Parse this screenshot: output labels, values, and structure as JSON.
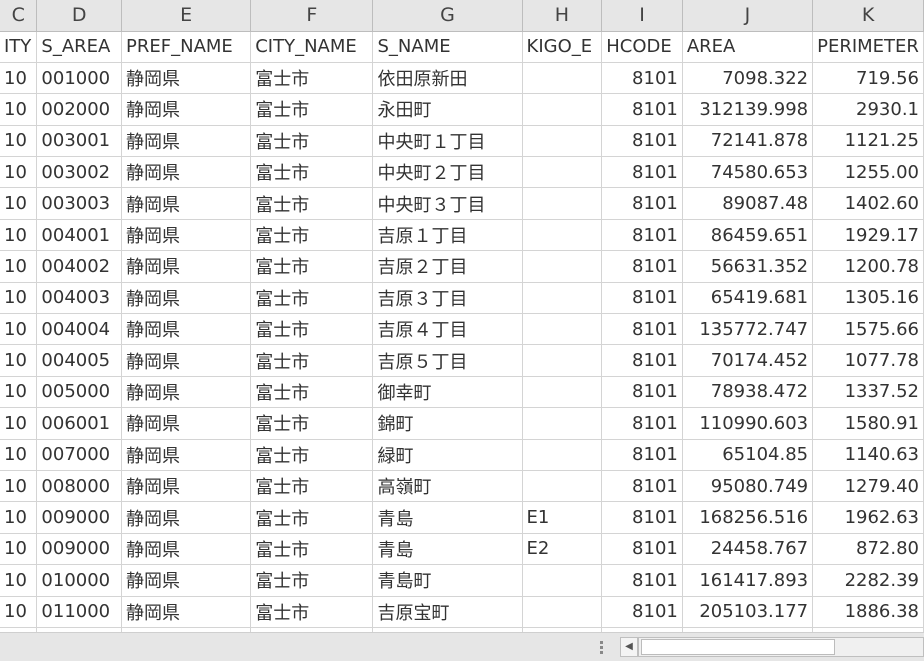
{
  "column_letters": [
    "C",
    "D",
    "E",
    "F",
    "G",
    "H",
    "I",
    "J",
    "K"
  ],
  "field_headers": [
    "ITY",
    "S_AREA",
    "PREF_NAME",
    "CITY_NAME",
    "S_NAME",
    "KIGO_E",
    "HCODE",
    "AREA",
    "PERIMETER"
  ],
  "rows": [
    [
      "10",
      "001000",
      "静岡県",
      "富士市",
      "依田原新田",
      "",
      "8101",
      "7098.322",
      "719.56"
    ],
    [
      "10",
      "002000",
      "静岡県",
      "富士市",
      "永田町",
      "",
      "8101",
      "312139.998",
      "2930.1"
    ],
    [
      "10",
      "003001",
      "静岡県",
      "富士市",
      "中央町１丁目",
      "",
      "8101",
      "72141.878",
      "1121.25"
    ],
    [
      "10",
      "003002",
      "静岡県",
      "富士市",
      "中央町２丁目",
      "",
      "8101",
      "74580.653",
      "1255.00"
    ],
    [
      "10",
      "003003",
      "静岡県",
      "富士市",
      "中央町３丁目",
      "",
      "8101",
      "89087.48",
      "1402.60"
    ],
    [
      "10",
      "004001",
      "静岡県",
      "富士市",
      "吉原１丁目",
      "",
      "8101",
      "86459.651",
      "1929.17"
    ],
    [
      "10",
      "004002",
      "静岡県",
      "富士市",
      "吉原２丁目",
      "",
      "8101",
      "56631.352",
      "1200.78"
    ],
    [
      "10",
      "004003",
      "静岡県",
      "富士市",
      "吉原３丁目",
      "",
      "8101",
      "65419.681",
      "1305.16"
    ],
    [
      "10",
      "004004",
      "静岡県",
      "富士市",
      "吉原４丁目",
      "",
      "8101",
      "135772.747",
      "1575.66"
    ],
    [
      "10",
      "004005",
      "静岡県",
      "富士市",
      "吉原５丁目",
      "",
      "8101",
      "70174.452",
      "1077.78"
    ],
    [
      "10",
      "005000",
      "静岡県",
      "富士市",
      "御幸町",
      "",
      "8101",
      "78938.472",
      "1337.52"
    ],
    [
      "10",
      "006001",
      "静岡県",
      "富士市",
      "錦町",
      "",
      "8101",
      "110990.603",
      "1580.91"
    ],
    [
      "10",
      "007000",
      "静岡県",
      "富士市",
      "緑町",
      "",
      "8101",
      "65104.85",
      "1140.63"
    ],
    [
      "10",
      "008000",
      "静岡県",
      "富士市",
      "高嶺町",
      "",
      "8101",
      "95080.749",
      "1279.40"
    ],
    [
      "10",
      "009000",
      "静岡県",
      "富士市",
      "青島",
      "E1",
      "8101",
      "168256.516",
      "1962.63"
    ],
    [
      "10",
      "009000",
      "静岡県",
      "富士市",
      "青島",
      "E2",
      "8101",
      "24458.767",
      "872.80"
    ],
    [
      "10",
      "010000",
      "静岡県",
      "富士市",
      "青島町",
      "",
      "8101",
      "161417.893",
      "2282.39"
    ],
    [
      "10",
      "011000",
      "静岡県",
      "富士市",
      "吉原宝町",
      "",
      "8101",
      "205103.177",
      "1886.38"
    ],
    [
      "",
      "",
      "",
      "",
      "",
      "",
      "",
      "",
      ""
    ]
  ],
  "scroll_left_icon": "triangle-left-icon",
  "grip_icon": "vertical-dots-icon"
}
